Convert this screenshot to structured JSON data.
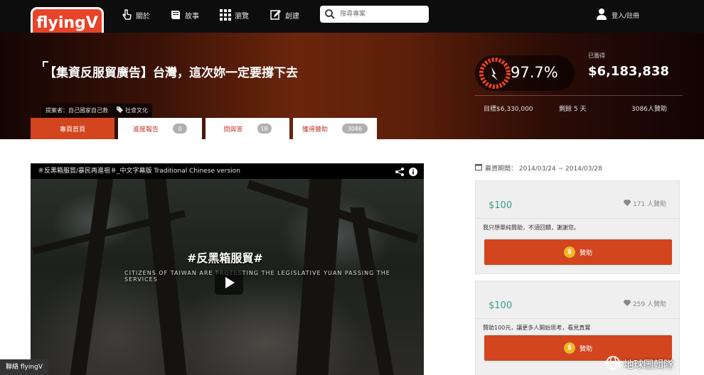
{
  "nav": {
    "logo": "flyingV",
    "items": [
      {
        "label": "關於",
        "icon": "hand-pointer-icon"
      },
      {
        "label": "故事",
        "icon": "book-icon"
      },
      {
        "label": "瀏覽",
        "icon": "grid-icon"
      },
      {
        "label": "創建",
        "icon": "pencil-icon"
      }
    ],
    "search_placeholder": "搜尋專案",
    "login": "登入/註冊"
  },
  "project": {
    "title": "【集資反服貿廣告】台灣，這次妳一定要撐下去",
    "proposer": "提案者：自己國家自己救",
    "category": "社會文化"
  },
  "tabs": [
    {
      "label": "專頁首頁"
    },
    {
      "label": "進度報告",
      "count": "0"
    },
    {
      "label": "問與答",
      "count": "18"
    },
    {
      "label": "獲得贊助",
      "count": "3086"
    }
  ],
  "stats": {
    "percent": "97.7%",
    "raised_label": "已籌得",
    "raised": "$6,183,838",
    "goal": "目標$6,330,000",
    "remaining": "剩餘 5 天",
    "backers": "3086人贊助"
  },
  "video": {
    "title": "＃反黑箱服貿/暴民再進祖＃_中文字幕版 Traditional Chinese version",
    "overlay_title": "#反黑箱服貿#",
    "overlay_subtitle": "CITIZENS OF TAIWAN ARE PROTESTING THE LEGISLATIVE YUAN PASSING THE SERVICES"
  },
  "funding": {
    "period": "募資期間： 2014/03/24 ~ 2014/03/28",
    "rewards": [
      {
        "price": "$100",
        "backers": "171 人贊助",
        "desc": "我只想單純贊助，不須回饋，謝謝您。",
        "button": "贊助"
      },
      {
        "price": "$100",
        "backers": "259 人贊助",
        "desc": "贊助100元，讓更多人開始思考，看見真實",
        "button": "贊助"
      }
    ]
  },
  "contact": "聯絡 flyingV",
  "watermark": "地球圖輯隊",
  "colors": {
    "accent": "#d2451e",
    "price": "#3a9b8a",
    "coin": "#f1b525"
  }
}
